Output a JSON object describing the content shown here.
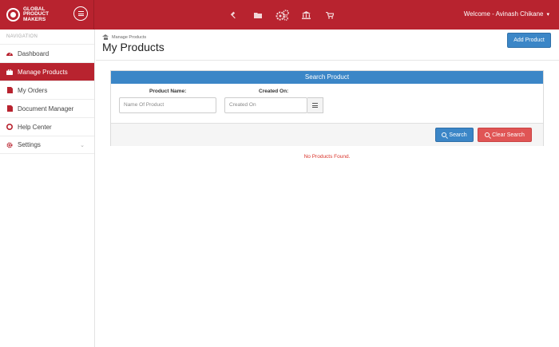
{
  "brand": {
    "line1": "GLOBAL",
    "line2": "PRODUCT",
    "line3": "MAKERS"
  },
  "topbar": {
    "icons": [
      "gavel-icon",
      "folder-icon",
      "cogs-icon",
      "bank-icon",
      "cart-icon"
    ],
    "welcome": "Welcome - Avinash Chikane"
  },
  "sidebar": {
    "header": "NAVIGATION",
    "items": [
      {
        "label": "Dashboard",
        "icon": "dashboard-icon"
      },
      {
        "label": "Manage Products",
        "icon": "products-icon",
        "active": true
      },
      {
        "label": "My Orders",
        "icon": "orders-icon"
      },
      {
        "label": "Document Manager",
        "icon": "document-icon"
      },
      {
        "label": "Help Center",
        "icon": "lifebuoy-icon"
      },
      {
        "label": "Settings",
        "icon": "settings-icon"
      }
    ]
  },
  "header": {
    "breadcrumb": "Manage Products",
    "title": "My Products",
    "add_button": "Add Product"
  },
  "search": {
    "title": "Search Product",
    "product_name_label": "Product Name:",
    "product_name_placeholder": "Name Of Product",
    "created_on_label": "Created On:",
    "created_on_placeholder": "Created On",
    "search_button": "Search",
    "clear_button": "Clear Search"
  },
  "results": {
    "empty_message": "No Products Found."
  },
  "colors": {
    "brand": "#b8232f",
    "primary": "#3b86c7",
    "danger": "#e05555",
    "empty_text": "#d9342b"
  }
}
